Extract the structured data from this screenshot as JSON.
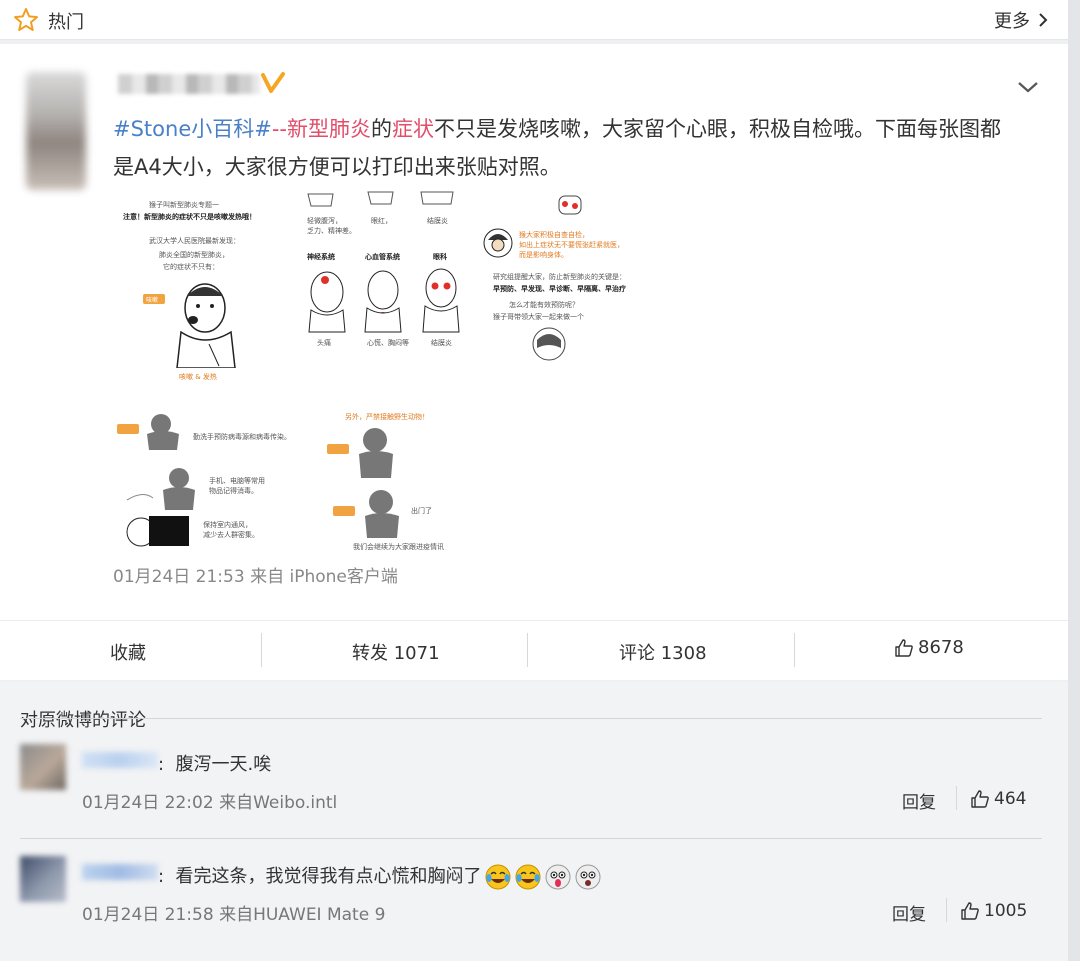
{
  "topbar": {
    "title": "热门",
    "more_label": "更多"
  },
  "post": {
    "text_hashtag": "#Stone小百科#",
    "text_sep": "--",
    "text_kw1": "新型肺炎",
    "text_de": "的",
    "text_kw2": "症状",
    "text_rest": "不只是发烧咳嗽，大家留个心眼，积极自检哦。下面每张图都是A4大小，大家很方便可以打印出来张贴对照。",
    "time": "01月24日 21:53",
    "source": "来自 iPhone客户端",
    "image_captions": {
      "p1_title1": "猴子叫新型肺炎专题一",
      "p1_title2": "注意！新型肺炎的症状不只是咳嗽发热哦！",
      "p1_line1": "武汉大学人民医院最新发现：",
      "p1_line2": "肺炎全国的新型肺炎，",
      "p1_line3": "它的症状不只有：",
      "p1_tag": "咳嗽",
      "p1_bottom": "咳嗽 & 发热",
      "p2_c1": "轻微腹泻，",
      "p2_c1b": "乏力、精神差。",
      "p2_c2": "眼红，",
      "p2_c3": "结膜炎",
      "p2_sec1": "神经系统",
      "p2_sec2": "心血管系统",
      "p2_sec3": "眼科",
      "p2_b1": "头痛",
      "p2_b2": "心慌、胸闷等",
      "p2_b3": "结膜炎",
      "p3_l1": "猴大家积极自查自检，",
      "p3_l2": "如出上症状无不要慌张赶紧就医，",
      "p3_l3": "而是影响身体。",
      "p3_l4": "研究组提醒大家，防止新型肺炎的关键是：",
      "p3_l5": "早预防、早发现、早诊断、早隔离、早治疗",
      "p3_l6": "怎么才能有效预防呢？",
      "p3_l7": "猴子哥带领大家一起来做一个",
      "p4_l1": "勤洗手预防病毒源和病毒传染。",
      "p4_l2": "手机、电脑等常用",
      "p4_l2b": "物品记得消毒。",
      "p4_l3": "保持室内通风，",
      "p4_l3b": "减少去人群密集。",
      "p5_l1": "另外，严禁接触野生动物！",
      "p5_l2": "我们会继续为大家跟进疫情讯",
      "p5_bubble": "出门了"
    }
  },
  "actions": {
    "favorite": "收藏",
    "repost": "转发 1071",
    "comment": "评论 1308",
    "likes": "8678"
  },
  "comments": {
    "heading": "对原微博的评论",
    "items": [
      {
        "text": "腹泻一天.唉",
        "time": "01月24日 22:02",
        "source": "来自Weibo.intl",
        "reply": "回复",
        "likes": "464"
      },
      {
        "text": "看完这条，我觉得我有点心慌和胸闷了",
        "time": "01月24日 21:58",
        "source": "来自HUAWEI Mate 9",
        "reply": "回复",
        "likes": "1005"
      }
    ]
  },
  "colors": {
    "hashtag": "#4a80c8",
    "keyword": "#e24d6a",
    "badge": "#f5a623"
  }
}
